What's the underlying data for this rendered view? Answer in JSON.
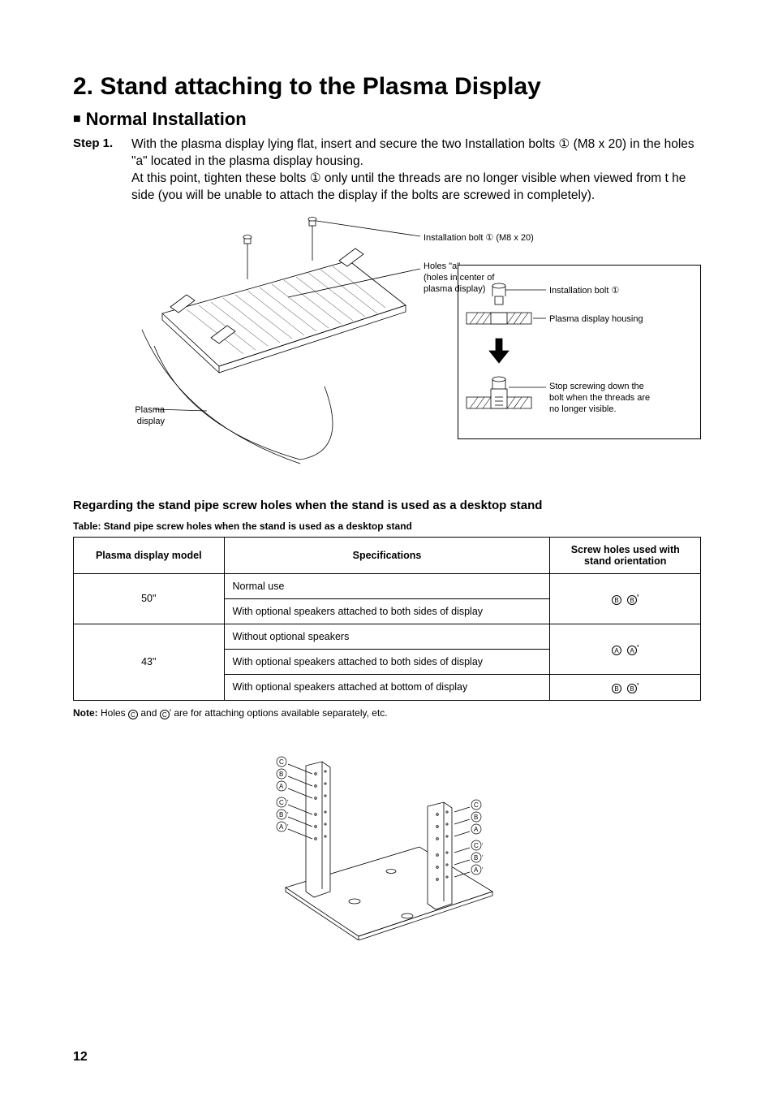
{
  "title": "2.  Stand attaching to the Plasma Display",
  "section": "Normal Installation",
  "step_label": "Step 1.",
  "step_text_l1": "With the plasma display lying flat, insert and secure the two Installation bolts ① (M8 x 20) in the holes \"a\" located in the plasma display housing.",
  "step_text_l2": "At this point, tighten these bolts ① only until the threads are no longer visible when viewed from t he side (you will be unable to attach the display if the bolts are screwed in completely).",
  "diagram": {
    "label_bolt": "Installation bolt ① (M8 x 20)",
    "label_holes_l1": "Holes \"a\"",
    "label_holes_l2": "(holes in center of",
    "label_holes_l3": "plasma display)",
    "label_plasma": "Plasma display",
    "inset_bolt": "Installation bolt ①",
    "inset_housing": "Plasma display housing",
    "inset_stop_l1": "Stop screwing down the",
    "inset_stop_l2": "bolt when the threads are",
    "inset_stop_l3": "no longer visible."
  },
  "subhead": "Regarding the stand pipe screw holes when the stand is used as a desktop stand",
  "table_caption": "Table: Stand pipe screw holes when the stand is used as a desktop stand",
  "table": {
    "headers": [
      "Plasma display model",
      "Specifications",
      "Screw holes used with stand orientation"
    ],
    "row1": {
      "model": "50\"",
      "spec1": "Normal use",
      "spec2": "With optional speakers attached to both sides of display",
      "holes": "Ⓑ Ⓑ'"
    },
    "row2": {
      "model": "43\"",
      "spec1": "Without optional speakers",
      "spec2": "With optional speakers attached to both sides of display",
      "spec3": "With optional speakers attached at bottom of display",
      "holes12": "Ⓐ Ⓐ'",
      "holes3": "Ⓑ Ⓑ'"
    }
  },
  "note_pre": "Note:",
  "note_text": " Holes Ⓒ and Ⓒ' are for attaching options available separately, etc.",
  "pagenum": "12",
  "letters": {
    "A": "A",
    "B": "B",
    "C": "C"
  }
}
